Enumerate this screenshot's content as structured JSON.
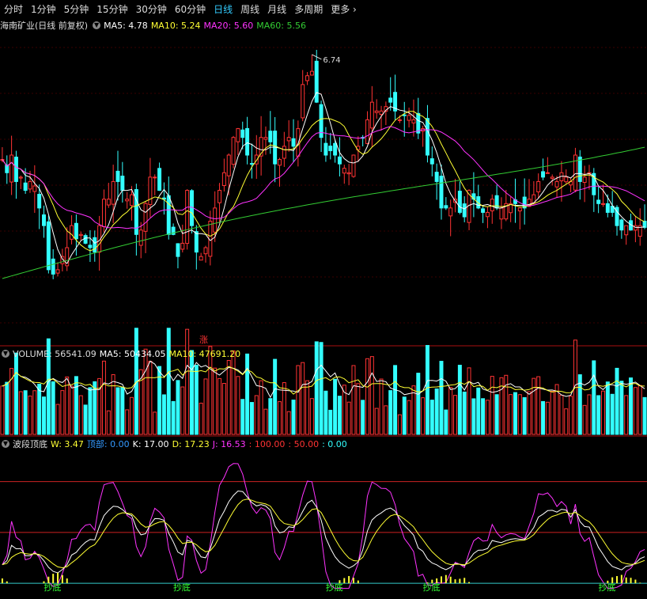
{
  "periods": [
    "分时",
    "1分钟",
    "5分钟",
    "15分钟",
    "30分钟",
    "60分钟",
    "日线",
    "周线",
    "月线",
    "多周期",
    "更多"
  ],
  "active_period": "日线",
  "more_icon": "chevron-right-icon",
  "main": {
    "title": "海南矿业(日线 前复权)",
    "ma5_label": "MA5: 4.78",
    "ma10_label": "MA10: 5.24",
    "ma20_label": "MA20: 5.60",
    "ma60_label": "MA60: 5.56",
    "high_marker": "6.74",
    "zhang_label": "涨",
    "colors": {
      "up": "#ff3333",
      "down": "#33ffff",
      "ma5": "#ffffff",
      "ma10": "#ffff33",
      "ma20": "#ff33ff",
      "ma60": "#33cc33"
    }
  },
  "volume": {
    "vol_label": "VOLUME: 56541.09",
    "ma5_label": "MA5: 50434.05",
    "ma10_label": "MA10: 47691.20"
  },
  "indicator": {
    "name": "波段顶底",
    "w_label": "W: 3.47",
    "top_label": "顶部: 0.00",
    "k_label": "K: 17.00",
    "d_label": "D: 17.23",
    "j_label": "J: 16.53",
    "l100": ": 100.00",
    "l50": ": 50.00",
    "l0": ": 0.00",
    "signal": "抄底"
  },
  "chart_data": [
    {
      "type": "candlestick",
      "title": "海南矿业(日线 前复权)",
      "high_label_value": 6.74,
      "ma_latest": {
        "MA5": 4.78,
        "MA10": 5.24,
        "MA20": 5.6,
        "MA60": 5.56
      },
      "close": [
        5.55,
        5.4,
        5.6,
        5.3,
        5.35,
        5.2,
        5.3,
        5.25,
        5.0,
        4.8,
        4.3,
        4.25,
        4.3,
        4.45,
        4.55,
        4.8,
        4.65,
        4.7,
        4.6,
        4.55,
        4.5,
        4.8,
        5.1,
        5.1,
        5.3,
        5.3,
        5.2,
        5.1,
        5.15,
        4.7,
        4.75,
        5.05,
        5.35,
        5.35,
        5.2,
        5.1,
        4.7,
        4.7,
        4.45,
        4.6,
        5.2,
        4.8,
        4.5,
        4.45,
        4.55,
        4.85,
        5.0,
        5.2,
        5.4,
        5.6,
        5.8,
        5.9,
        5.8,
        5.6,
        5.5,
        5.6,
        5.8,
        5.8,
        5.75,
        5.5,
        5.55,
        5.7,
        5.8,
        5.7,
        5.9,
        6.4,
        6.5,
        6.55,
        6.2,
        5.8,
        5.6,
        5.65,
        5.6,
        5.5,
        5.45,
        5.4,
        5.6,
        5.7,
        5.8,
        6.0,
        6.2,
        6.1,
        6.1,
        6.15,
        6.2,
        6.1,
        6.0,
        6.05,
        6.05,
        6.0,
        5.85,
        5.9,
        5.6,
        5.5,
        5.3,
        5.0,
        5.0,
        5.0,
        5.1,
        4.95,
        4.9,
        5.2,
        5.1,
        5.0,
        4.95,
        4.95,
        5.1,
        5.0,
        5.0,
        5.05,
        5.05,
        5.05,
        5.0,
        5.0,
        5.1,
        5.15,
        5.3,
        5.35,
        5.4,
        5.35,
        5.3,
        5.4,
        5.35,
        5.3,
        5.6,
        5.3,
        5.35,
        5.4,
        5.15,
        5.05,
        5.05,
        4.95,
        4.95,
        4.8,
        4.75,
        4.8,
        4.75,
        4.8,
        4.8,
        4.78
      ],
      "ylim": [
        3.5,
        7.0
      ]
    },
    {
      "type": "bar",
      "title": "VOLUME",
      "latest": 56541.09,
      "ma5": 50434.05,
      "ma10": 47691.2,
      "ylim": [
        0,
        100000
      ]
    },
    {
      "type": "line",
      "title": "波段顶底",
      "series_latest": {
        "W": 3.47,
        "顶部": 0.0,
        "K": 17.0,
        "D": 17.23,
        "J": 16.53
      },
      "reference_lines": [
        100,
        50,
        0
      ],
      "ylim": [
        -10,
        130
      ]
    }
  ]
}
